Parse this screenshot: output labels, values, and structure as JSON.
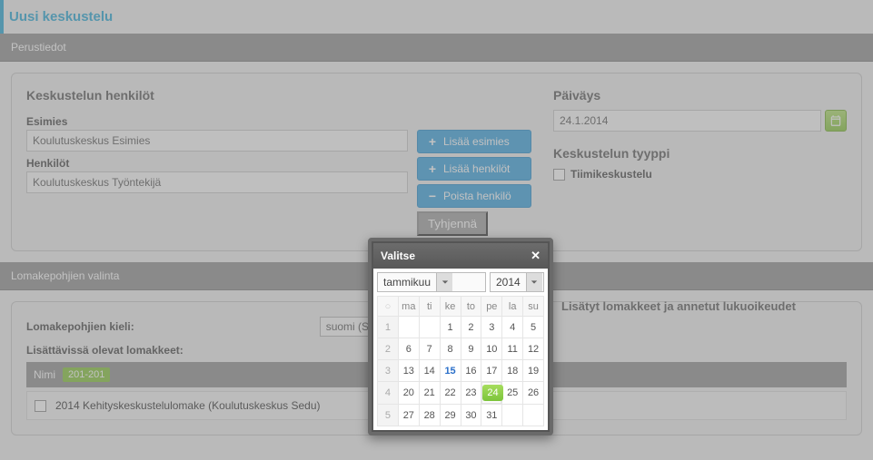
{
  "pageTitle": "Uusi keskustelu",
  "panel1": {
    "title": "Perustiedot"
  },
  "persons": {
    "title": "Keskustelun henkilöt",
    "managerLabel": "Esimies",
    "managerValue": "Koulutuskeskus Esimies",
    "personsLabel": "Henkilöt",
    "personsValue": "Koulutuskeskus Työntekijä",
    "btnAddManager": "Lisää esimies",
    "btnAddPerson": "Lisää henkilöt",
    "btnRemovePerson": "Poista henkilö",
    "btnClear": "Tyhjennä"
  },
  "date": {
    "title": "Päiväys",
    "value": "24.1.2014",
    "typeTitle": "Keskustelun tyyppi",
    "teamLabel": "Tiimikeskustelu"
  },
  "panel2": {
    "title": "Lomakepohjien valinta",
    "langLabel": "Lomakepohjien kieli:",
    "langValue": "suomi (S",
    "availableLabel": "Lisättävissä olevat lomakkeet:",
    "colName": "Nimi",
    "badge": "201-201",
    "row1": "2014 Kehityskeskustelulomake (Koulutuskeskus Sedu)",
    "rightTitle": "Lisätyt lomakkeet ja annetut lukuoikeudet"
  },
  "modal": {
    "title": "Valitse",
    "month": "tammikuu",
    "year": "2014",
    "weekdays": [
      "ma",
      "ti",
      "ke",
      "to",
      "pe",
      "la",
      "su"
    ],
    "weeks": [
      {
        "wk": "1",
        "days": [
          "",
          "",
          "1",
          "2",
          "3",
          "4",
          "5"
        ]
      },
      {
        "wk": "2",
        "days": [
          "6",
          "7",
          "8",
          "9",
          "10",
          "11",
          "12"
        ]
      },
      {
        "wk": "3",
        "days": [
          "13",
          "14",
          "15",
          "16",
          "17",
          "18",
          "19"
        ]
      },
      {
        "wk": "4",
        "days": [
          "20",
          "21",
          "22",
          "23",
          "24",
          "25",
          "26"
        ]
      },
      {
        "wk": "5",
        "days": [
          "27",
          "28",
          "29",
          "30",
          "31",
          "",
          ""
        ]
      }
    ],
    "today": "15",
    "selected": "24"
  }
}
